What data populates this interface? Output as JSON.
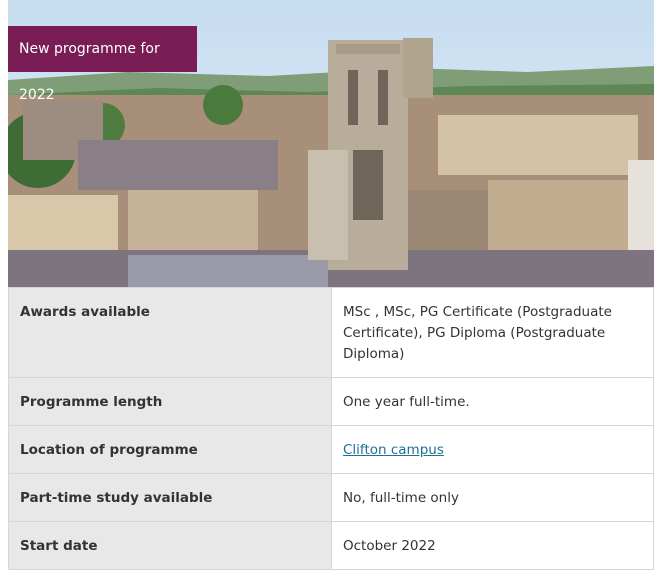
{
  "hero": {
    "badge": "New programme for 2022",
    "image_desc": "aerial-city-with-gothic-tower",
    "colors": {
      "badge_bg": "#7a1d57",
      "sky": "#cfe3f2"
    }
  },
  "facts": [
    {
      "label": "Awards available",
      "value": "MSc , MSc, PG Certificate (Postgraduate Certificate), PG Diploma (Postgraduate Diploma)"
    },
    {
      "label": "Programme length",
      "value": "One year full-time."
    },
    {
      "label": "Location of programme",
      "value": "Clifton campus"
    },
    {
      "label": "Part-time study available",
      "value": "No, full-time only"
    },
    {
      "label": "Start date",
      "value": "October 2022"
    }
  ]
}
